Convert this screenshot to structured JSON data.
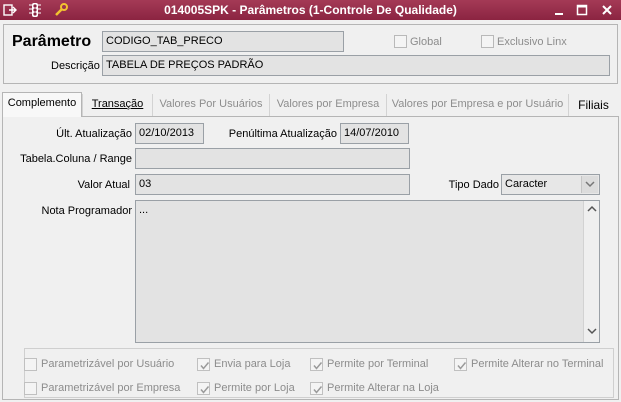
{
  "window": {
    "title": "014005SPK - Parâmetros (1-Controle De Qualidade)"
  },
  "header": {
    "parametro_label": "Parâmetro",
    "parametro_value": "CODIGO_TAB_PRECO",
    "global_label": "Global",
    "exclusivo_label": "Exclusivo Linx",
    "descricao_label": "Descrição",
    "descricao_value": "TABELA DE PREÇOS PADRÃO"
  },
  "tabs": [
    {
      "label": "Complemento",
      "state": "active"
    },
    {
      "label": "Transação",
      "state": "normal"
    },
    {
      "label": "Valores Por Usuários",
      "state": "disabled"
    },
    {
      "label": "Valores por Empresa",
      "state": "disabled"
    },
    {
      "label": "Valores por Empresa e por Usuário",
      "state": "disabled"
    },
    {
      "label": "Filiais",
      "state": "normal"
    }
  ],
  "form": {
    "ult_atualizacao_label": "Últ. Atualização",
    "ult_atualizacao_value": "02/10/2013",
    "penultima_label": "Penúltima Atualização",
    "penultima_value": "14/07/2010",
    "tabela_label": "Tabela.Coluna / Range",
    "tabela_value": "",
    "valor_atual_label": "Valor Atual",
    "valor_atual_value": "03",
    "tipo_dado_label": "Tipo Dado",
    "tipo_dado_value": "Caracter",
    "nota_label": "Nota Programador",
    "nota_value": "..."
  },
  "checkboxes": {
    "param_usuario": {
      "label": "Parametrizável por Usuário",
      "checked": false
    },
    "envia_loja": {
      "label": "Envia para Loja",
      "checked": true
    },
    "permite_terminal": {
      "label": "Permite por Terminal",
      "checked": true
    },
    "permite_alterar_terminal": {
      "label": "Permite Alterar no Terminal",
      "checked": true
    },
    "param_empresa": {
      "label": "Parametrizável por Empresa",
      "checked": false
    },
    "permite_loja": {
      "label": "Permite por Loja",
      "checked": true
    },
    "permite_alterar_loja": {
      "label": "Permite Alterar na Loja",
      "checked": true
    }
  },
  "colors": {
    "titlebar": "#8b2441",
    "disabled_text": "#8c8c8c"
  }
}
